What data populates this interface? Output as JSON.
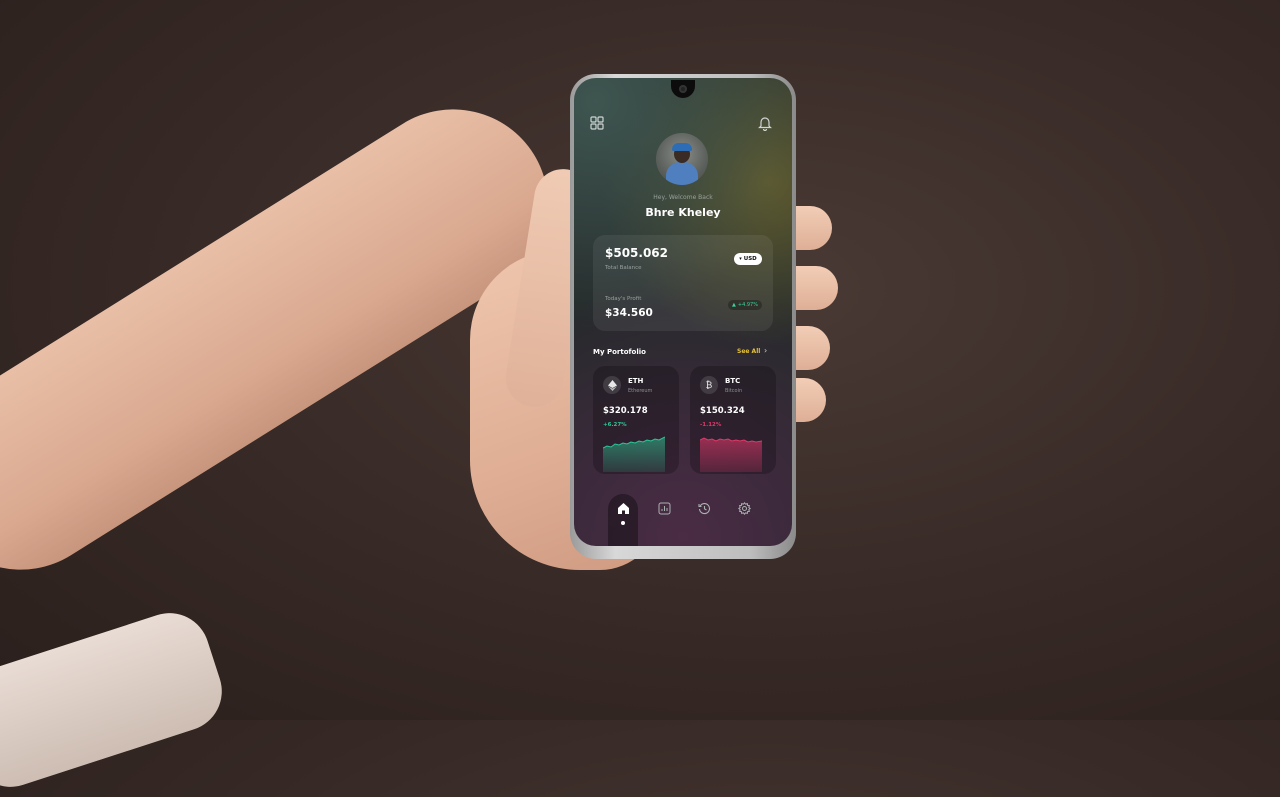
{
  "header": {
    "menu_icon": "grid-icon",
    "notification_icon": "bell-icon",
    "welcome_text": "Hey, Welcome Back",
    "user_name": "Bhre Kheley"
  },
  "balance": {
    "amount": "$505.062",
    "label": "Total Balance",
    "currency": "USD",
    "profit_label": "Today's Profit",
    "profit_amount": "$34.560",
    "profit_change": "+4.97%"
  },
  "portfolio": {
    "title": "My Portofolio",
    "see_all": "See All",
    "coins": [
      {
        "symbol": "ETH",
        "name": "Ethereum",
        "price": "$320.178",
        "change": "+6.27%",
        "trend_color": "#2fc596"
      },
      {
        "symbol": "BTC",
        "name": "Bitcoin",
        "price": "$150.324",
        "change": "-1.12%",
        "trend_color": "#e0386a"
      }
    ]
  },
  "nav": {
    "items": [
      "home-icon",
      "chart-icon",
      "history-icon",
      "settings-icon"
    ],
    "active": "home-icon"
  }
}
